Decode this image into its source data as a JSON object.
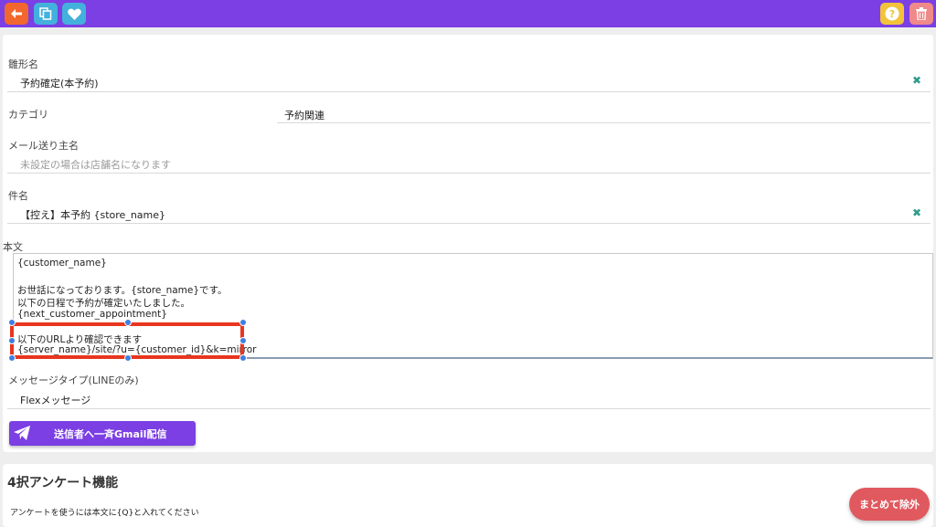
{
  "toolbar": {
    "back_icon": "arrow-left-icon",
    "copy_icon": "copy-icon",
    "favorite_icon": "heart-icon",
    "help_icon": "question-icon",
    "delete_icon": "trash-icon",
    "colors": {
      "bar": "#7b3fe4",
      "back": "#f2672d",
      "copy": "#44b0dc",
      "help": "#f2c33a",
      "delete": "#f08a8a"
    }
  },
  "form": {
    "template_name_label": "雛形名",
    "template_name_value": "予約確定(本予約)",
    "category_label": "カテゴリ",
    "category_value": "予約関連",
    "sender_label": "メール送り主名",
    "sender_placeholder": "未設定の場合は店舗名になります",
    "subject_label": "件名",
    "subject_value": "【控え】本予約 {store_name}",
    "body_label": "本文",
    "body_lines": [
      "{customer_name}",
      "",
      "お世話になっております。{store_name}です。",
      "以下の日程で予約が確定いたしました。",
      "{next_customer_appointment}",
      "",
      "以下のURLより確認できます",
      "{server_name}/site/?u={customer_id}&k=mirror"
    ],
    "message_type_label": "メッセージタイプ(LINEのみ)",
    "message_type_value": "Flexメッセージ",
    "gmail_button_label": "送信者へ一斉Gmail配信",
    "gmail_button_icon": "paper-plane-icon",
    "clear_icon": "close-icon"
  },
  "survey": {
    "title": "4択アンケート機能",
    "hint": "アンケートを使うには本文に{Q}と入れてください"
  },
  "fab": {
    "label": "まとめて除外",
    "color": "#e0595f"
  }
}
